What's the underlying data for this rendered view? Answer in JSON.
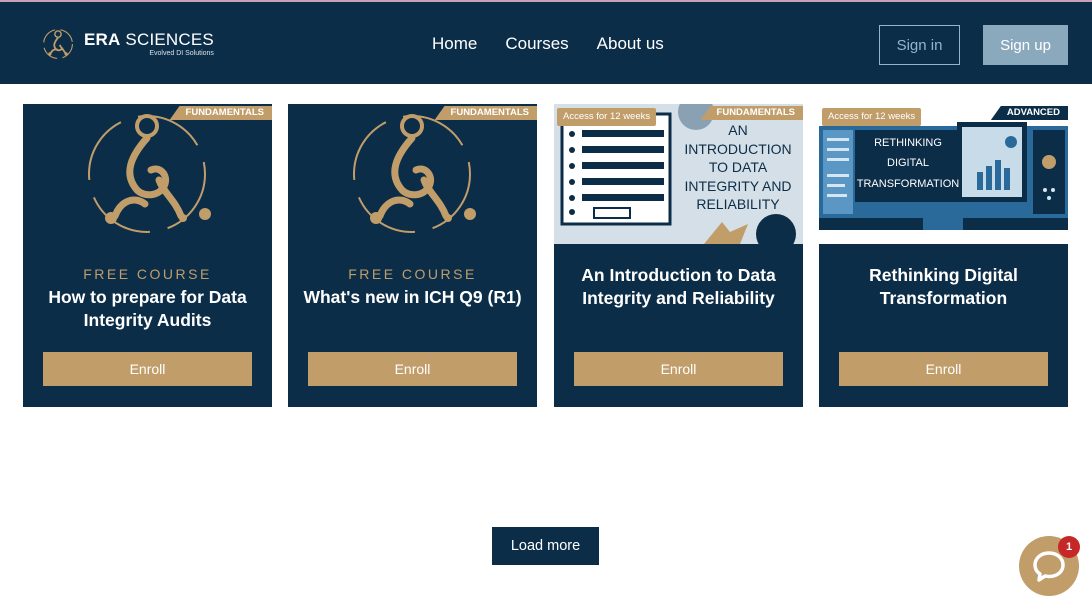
{
  "brand": {
    "name_bold": "ERA",
    "name_rest": " SCIENCES",
    "tagline": "Evolved DI Solutions"
  },
  "nav": {
    "links": [
      "Home",
      "Courses",
      "About us"
    ],
    "signin_label": "Sign in",
    "signup_label": "Sign up"
  },
  "courses": [
    {
      "ribbon": "FUNDAMENTALS",
      "kicker": "FREE COURSE",
      "title": "How to prepare for Data Integrity Audits",
      "enroll_label": "Enroll"
    },
    {
      "ribbon": "FUNDAMENTALS",
      "kicker": "FREE COURSE",
      "title": "What's new in ICH Q9 (R1)",
      "enroll_label": "Enroll"
    },
    {
      "ribbon": "FUNDAMENTALS",
      "access": "Access for 12 weeks",
      "image_text": [
        "AN",
        "INTRODUCTION",
        "TO DATA",
        "INTEGRITY AND",
        "RELIABILITY"
      ],
      "title": "An Introduction to Data Integrity and Reliability",
      "enroll_label": "Enroll"
    },
    {
      "ribbon": "ADVANCED",
      "access": "Access for 12 weeks",
      "image_text": [
        "RETHINKING",
        "DIGITAL",
        "TRANSFORMATION"
      ],
      "title": "Rethinking Digital Transformation",
      "enroll_label": "Enroll"
    }
  ],
  "load_more_label": "Load more",
  "chat": {
    "badge_count": "1"
  },
  "colors": {
    "navy": "#0c2d48",
    "gold": "#c19d6a",
    "signup_bg": "#8aa9bd",
    "badge": "#c62828"
  }
}
